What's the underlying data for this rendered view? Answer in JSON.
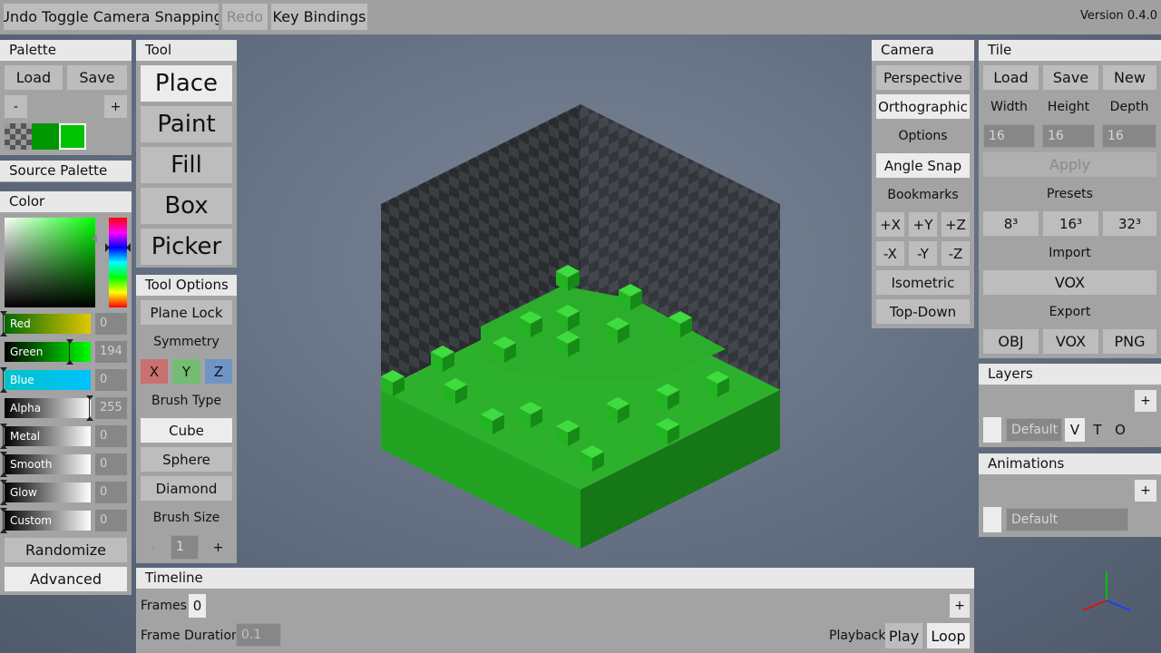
{
  "menu": {
    "undo": "Undo Toggle Camera Snapping",
    "redo": "Redo",
    "key_bindings": "Key Bindings",
    "version": "Version 0.4.0"
  },
  "palette": {
    "title": "Palette",
    "load": "Load",
    "save": "Save",
    "minus": "-",
    "plus": "+",
    "swatches": [
      "#009600",
      "#00c200"
    ]
  },
  "source_palette": {
    "title": "Source Palette"
  },
  "color": {
    "title": "Color",
    "sliders": [
      {
        "label": "Red",
        "value": "0",
        "start": "#006800",
        "end": "#e2c800"
      },
      {
        "label": "Green",
        "value": "194",
        "start": "#000000",
        "end": "#00ff00"
      },
      {
        "label": "Blue",
        "value": "0",
        "start": "#00c2c8",
        "end": "#00c2ff"
      },
      {
        "label": "Alpha",
        "value": "255",
        "start": "#000000",
        "end": "#ffffff"
      },
      {
        "label": "Metal",
        "value": "0",
        "start": "#000000",
        "end": "#ffffff"
      },
      {
        "label": "Smooth",
        "value": "0",
        "start": "#000000",
        "end": "#ffffff"
      },
      {
        "label": "Glow",
        "value": "0",
        "start": "#000000",
        "end": "#ffffff"
      },
      {
        "label": "Custom",
        "value": "0",
        "start": "#000000",
        "end": "#ffffff"
      }
    ],
    "randomize": "Randomize",
    "advanced": "Advanced"
  },
  "tool": {
    "title": "Tool",
    "tools": [
      "Place",
      "Paint",
      "Fill",
      "Box",
      "Picker"
    ],
    "selected": "Place"
  },
  "tool_options": {
    "title": "Tool Options",
    "plane_lock": "Plane Lock",
    "symmetry": "Symmetry",
    "sym_x": "X",
    "sym_y": "Y",
    "sym_z": "Z",
    "brush_type": "Brush Type",
    "brushes": [
      "Cube",
      "Sphere",
      "Diamond"
    ],
    "selected_brush": "Cube",
    "brush_size": "Brush Size",
    "size_minus": "-",
    "size_value": "1",
    "size_plus": "+"
  },
  "camera": {
    "title": "Camera",
    "perspective": "Perspective",
    "orthographic": "Orthographic",
    "options": "Options",
    "angle_snap": "Angle Snap",
    "bookmarks_label": "Bookmarks",
    "bookmarks": [
      "+X",
      "+Y",
      "+Z",
      "-X",
      "-Y",
      "-Z"
    ],
    "isometric": "Isometric",
    "top_down": "Top-Down"
  },
  "tile": {
    "title": "Tile",
    "load": "Load",
    "save": "Save",
    "new": "New",
    "width_label": "Width",
    "height_label": "Height",
    "depth_label": "Depth",
    "width": "16",
    "height": "16",
    "depth": "16",
    "apply": "Apply",
    "presets_label": "Presets",
    "presets": [
      "8³",
      "16³",
      "32³"
    ],
    "import_label": "Import",
    "import_vox": "VOX",
    "export_label": "Export",
    "exports": [
      "OBJ",
      "VOX",
      "PNG"
    ]
  },
  "layers": {
    "title": "Layers",
    "add": "+",
    "name": "Default",
    "v": "V",
    "t": "T",
    "o": "O"
  },
  "animations": {
    "title": "Animations",
    "add": "+",
    "name": "Default"
  },
  "timeline": {
    "title": "Timeline",
    "frames_label": "Frames",
    "frames_value": "0",
    "add": "+",
    "frame_duration_label": "Frame Duration",
    "frame_duration_placeholder": "0.1",
    "playback_label": "Playback",
    "play": "Play",
    "loop": "Loop"
  },
  "colors": {
    "accent_green": "#00c200",
    "panel": "#a3a3a3",
    "header": "#e8e8e8"
  }
}
